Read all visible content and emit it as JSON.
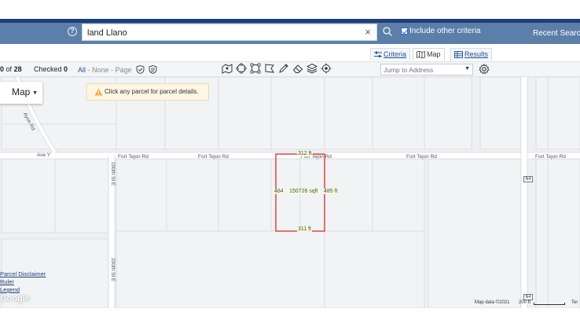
{
  "navbar": {
    "search_value": "land Llano",
    "include_other_label": "Include other criteria",
    "recent_search_label": "Recent Search"
  },
  "tabs": {
    "criteria": "Criteria",
    "map": "Map",
    "results": "Results"
  },
  "toolbar": {
    "count_prefix": "0",
    "count_of": "of",
    "count_total": "28",
    "checked_label": "Checked",
    "checked_value": "0",
    "select_all": "All",
    "select_none": "None",
    "select_page": "Page",
    "separator": " - ",
    "jump_placeholder": "Jump to Address"
  },
  "map": {
    "type_label": "Map",
    "hint_text": "Click any parcel for parcel details.",
    "roads": {
      "ave_y": "Ave Y",
      "fort_tejon_1": "Fort Tejon Rd",
      "fort_tejon_2": "Fort Tejon Rd",
      "fort_tejon_3": "Fort Tejon Rd",
      "fort_tejon_4": "Fort Tejon Rd",
      "fort_tejon_5": "Fort Tejon Rd",
      "st_200th_upper": "200th St E",
      "st_200th_lower": "200th St E",
      "rd_diag": "Ayon Rd",
      "highway_1": "N4",
      "highway_2": "N4"
    },
    "parcel": {
      "top": "312 ft",
      "bottom": "311 ft",
      "left": "484",
      "right": "485 ft",
      "area": "150726 sqft"
    },
    "links": [
      "Parcel Disclaimer",
      "Ruler",
      "Legend"
    ],
    "google": "Google",
    "attribution": "Map data ©2021",
    "scale": "200 ft",
    "terms": "Ter"
  },
  "colors": {
    "navbar": "#5b7fa8",
    "navbar_top": "#1f3f7a",
    "parcel_outline": "#d9534f",
    "link": "#1f4d9a"
  }
}
